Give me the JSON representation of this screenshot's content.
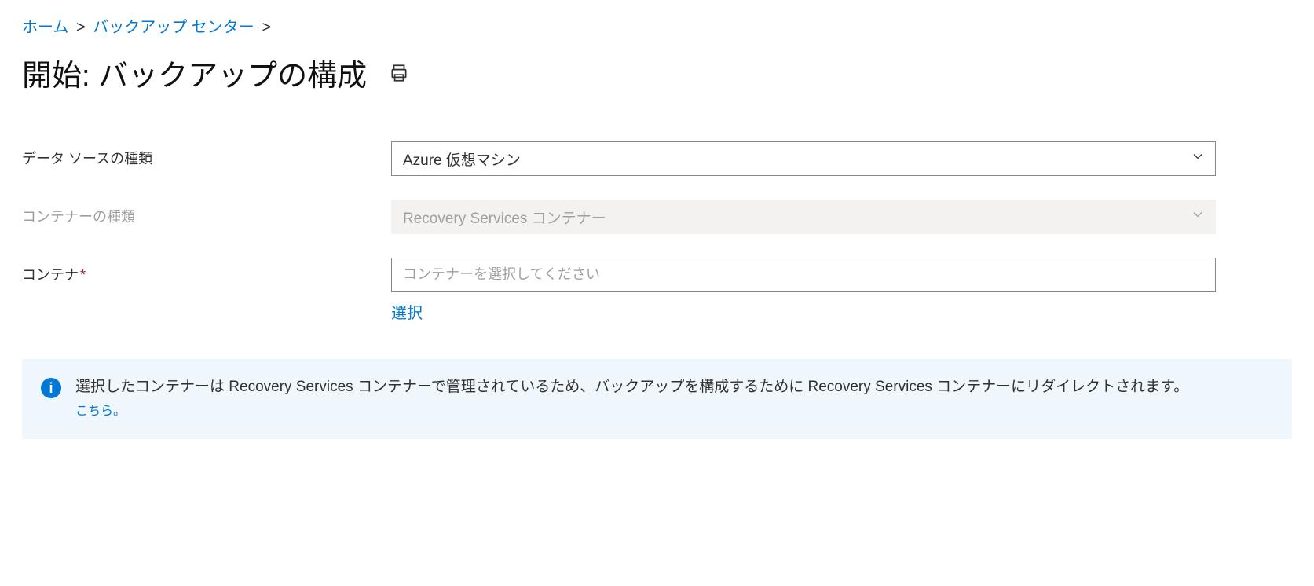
{
  "breadcrumb": {
    "home": "ホーム",
    "backup_center": "バックアップ センター"
  },
  "page": {
    "title": "開始: バックアップの構成"
  },
  "form": {
    "datasource_type": {
      "label": "データ ソースの種類",
      "value": "Azure 仮想マシン"
    },
    "container_type": {
      "label": "コンテナーの種類",
      "value": "Recovery Services コンテナー"
    },
    "container": {
      "label": "コンテナ",
      "placeholder": "コンテナーを選択してください",
      "select_link": "選択"
    }
  },
  "info": {
    "message": "選択したコンテナーは Recovery Services コンテナーで管理されているため、バックアップを構成するために Recovery Services コンテナーにリダイレクトされます。",
    "link": "こちら。"
  }
}
